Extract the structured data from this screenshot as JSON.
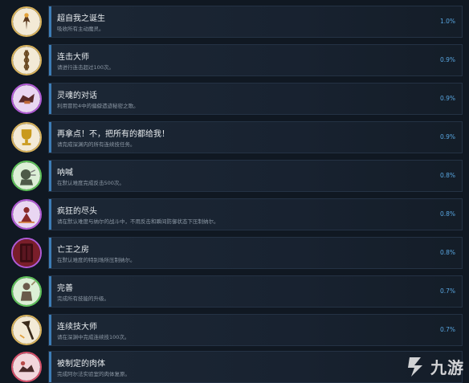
{
  "achievements": [
    {
      "title": "超自我之诞生",
      "desc": "吸收所有主动魔灵。",
      "pct": "1.0%",
      "icon": "hero-rising-icon",
      "ring": "#d9b35c",
      "bg": "#f3ead6",
      "fg": "#5b3a1f"
    },
    {
      "title": "连击大师",
      "desc": "请进行连击超过100次。",
      "pct": "0.9%",
      "icon": "chain-icon",
      "ring": "#d9b35c",
      "bg": "#f3ead6",
      "fg": "#6b4a22"
    },
    {
      "title": "灵魂的对话",
      "desc": "利用冒险4中的偏僻遗迹秘密之歌。",
      "pct": "0.9%",
      "icon": "soul-dialogue-icon",
      "ring": "#b25ad6",
      "bg": "#e9d6f2",
      "fg": "#5a2a2a"
    },
    {
      "title": "再拿点！不，把所有的都给我！",
      "desc": "请完成深渊内的所有连续技任务。",
      "pct": "0.9%",
      "icon": "trophy-icon",
      "ring": "#d9b35c",
      "bg": "#f3ead6",
      "fg": "#c99a1c"
    },
    {
      "title": "呐喊",
      "desc": "在默认难度完成反击500次。",
      "pct": "0.8%",
      "icon": "shout-icon",
      "ring": "#5fc25a",
      "bg": "#dcefd6",
      "fg": "#4d5a48"
    },
    {
      "title": "疯狂的尽头",
      "desc": "请在默认难度与纳尔的战斗中，不用反击和瞬间防御状态下压制纳尔。",
      "pct": "0.8%",
      "icon": "madness-icon",
      "ring": "#b25ad6",
      "bg": "#e9d6f2",
      "fg": "#8a2a2a"
    },
    {
      "title": "亡王之房",
      "desc": "在默认难度的特别场所压制纳尔。",
      "pct": "0.8%",
      "icon": "door-icon",
      "ring": "#b25ad6",
      "bg": "#7a1e2a",
      "fg": "#3a0c12"
    },
    {
      "title": "完善",
      "desc": "完成所有技能的升级。",
      "pct": "0.7%",
      "icon": "warrior-icon",
      "ring": "#5fc25a",
      "bg": "#dcefd6",
      "fg": "#6a5a4a"
    },
    {
      "title": "连续技大师",
      "desc": "请在深渊中完成连续技100次。",
      "pct": "0.7%",
      "icon": "axe-icon",
      "ring": "#d9b35c",
      "bg": "#f3ead6",
      "fg": "#3a2a1a"
    },
    {
      "title": "被制定的肉体",
      "desc": "完成阿尔法实验室的肉体复原。",
      "pct": "",
      "icon": "body-icon",
      "ring": "#d6506a",
      "bg": "#f2d6dc",
      "fg": "#4a2a2a"
    }
  ],
  "watermark": {
    "text": "九游",
    "icon": "jiuyou-logo"
  }
}
